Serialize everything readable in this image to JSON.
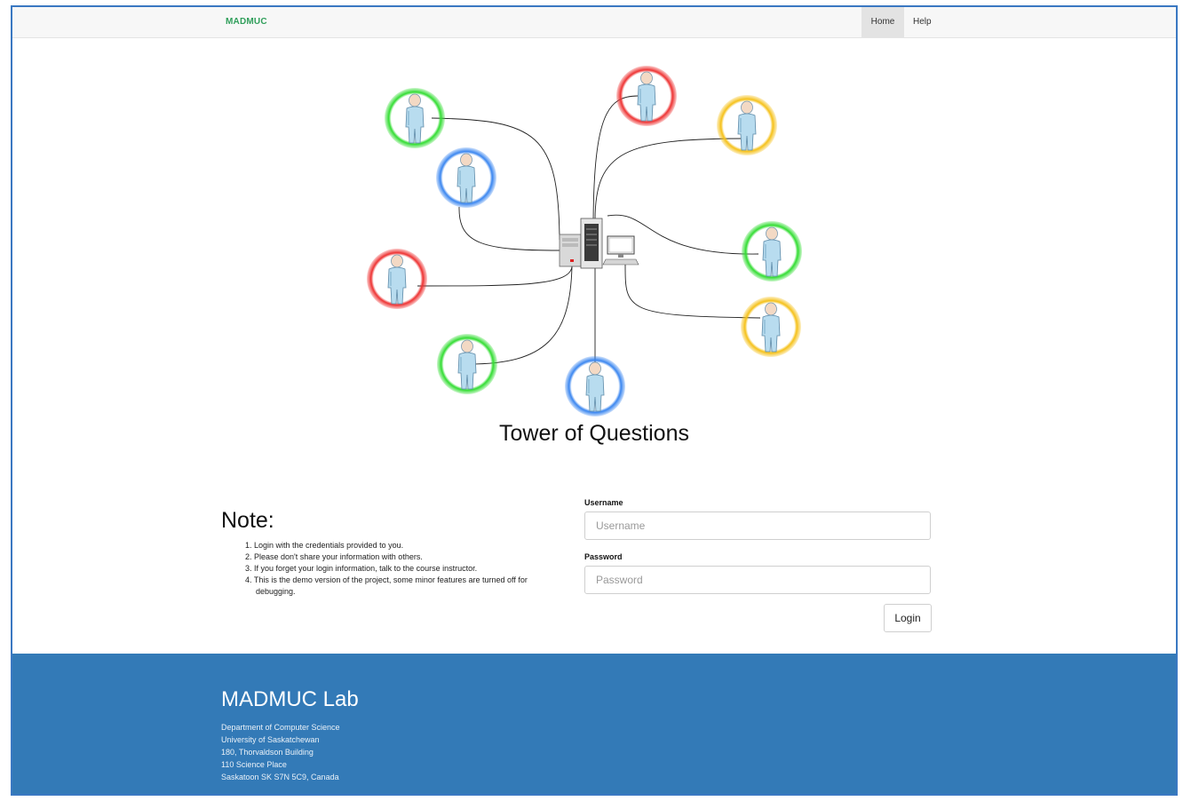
{
  "navbar": {
    "brand": "MADMUC",
    "links": [
      {
        "label": "Home",
        "active": true
      },
      {
        "label": "Help",
        "active": false
      }
    ]
  },
  "diagram": {
    "ring_colors": {
      "green": "#33dd33",
      "blue": "#3a86f0",
      "red": "#ee3333",
      "yellow": "#f5c11a"
    },
    "nodes": [
      "green",
      "blue",
      "red",
      "green",
      "blue",
      "red",
      "yellow",
      "green",
      "yellow"
    ],
    "center_icon": "server-and-computer-icon"
  },
  "page": {
    "title": "Tower of Questions"
  },
  "note": {
    "heading": "Note:",
    "items": [
      "1. Login with the credentials provided to you.",
      "2. Please don't share your information with others.",
      "3. If you forget your login information, talk to the course instructor.",
      "4. This is the demo version of the project, some minor features are turned off for debugging."
    ]
  },
  "login": {
    "username_label": "Username",
    "username_placeholder": "Username",
    "password_label": "Password",
    "password_placeholder": "Password",
    "button_label": "Login"
  },
  "footer": {
    "title": "MADMUC Lab",
    "lines": [
      "Department of Computer Science",
      "University of Saskatchewan",
      "180, Thorvaldson Building",
      "110 Science Place",
      "Saskatoon SK S7N 5C9, Canada"
    ]
  },
  "colors": {
    "brand": "#2f9e5a",
    "footer_bg": "#337ab7"
  }
}
